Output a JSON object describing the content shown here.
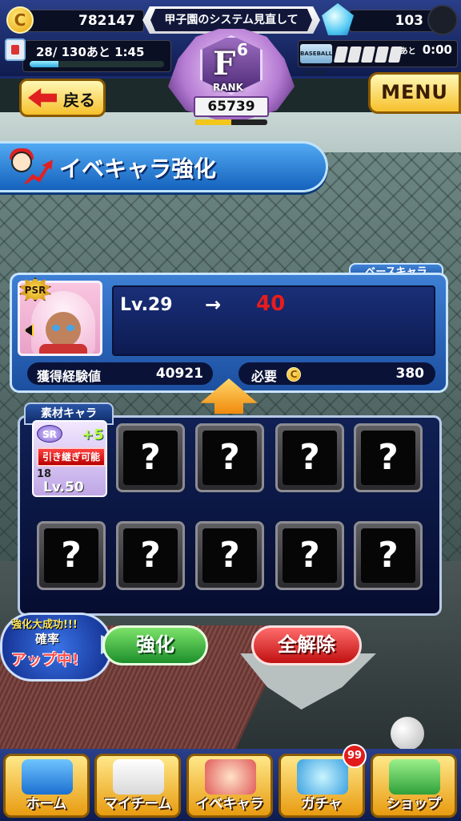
{
  "header": {
    "coins": "782147",
    "notice": "甲子園のシステム見直して",
    "gems": "103",
    "stamina_text": "28/ 130あと 1:45",
    "stamina_fill_percent": 21.5,
    "ticket_label": "BASEBALL TICKET",
    "ticket_remaining_label": "あと",
    "ticket_time": "0:00"
  },
  "rank": {
    "letter": "F",
    "sub": "6",
    "label": "RANK",
    "points": "65739",
    "progress_percent": 50
  },
  "nav": {
    "back_label": "戻る",
    "menu_label": "MENU"
  },
  "page": {
    "title": "イベキャラ強化"
  },
  "base": {
    "tab_label": "ベースキャラ",
    "rarity": "PSR",
    "level_current": "Lv.29",
    "level_arrow": "→",
    "level_next": "40",
    "exp_label": "獲得経験値",
    "exp_value": "40921",
    "need_label": "必要",
    "need_value": "380"
  },
  "material": {
    "tab_label": "素材キャラ",
    "card": {
      "rarity": "SR",
      "plus": "+5",
      "inherit": "引き継ぎ可能",
      "number": "18",
      "level": "Lv.50"
    },
    "empty_symbol": "?"
  },
  "bonus": {
    "line1": "強化大成功!!!",
    "line2": "確率",
    "line3": "アップ中!"
  },
  "actions": {
    "enhance": "強化",
    "release_all": "全解除"
  },
  "bottom_nav": {
    "items": [
      {
        "label": "ホーム",
        "icon": "home-icon"
      },
      {
        "label": "マイチーム",
        "icon": "team-icon"
      },
      {
        "label": "イベキャラ",
        "icon": "event-chara-icon"
      },
      {
        "label": "ガチャ",
        "icon": "gacha-icon"
      },
      {
        "label": "ショップ",
        "icon": "shop-icon"
      }
    ],
    "gacha_badge": "99"
  }
}
